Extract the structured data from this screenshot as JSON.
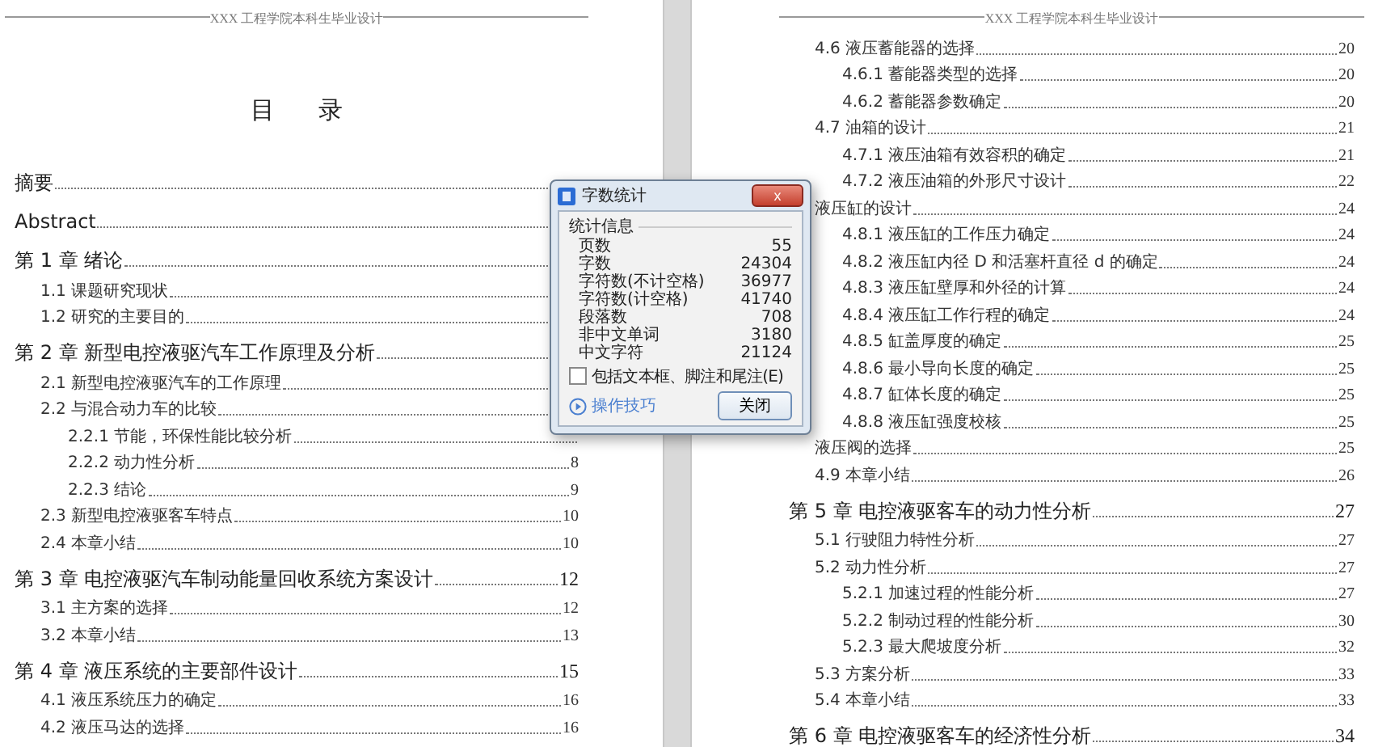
{
  "pages": [
    {
      "header": "XXX 工程学院本科生毕业设计",
      "title": "目 录",
      "entries": [
        {
          "kind": "chapter",
          "text": "摘要"
        },
        {
          "kind": "chapter",
          "text": "Abstract"
        },
        {
          "kind": "chapter",
          "text": "第 1 章  绪论",
          "children": [
            {
              "kind": "section",
              "text": "1.1 课题研究现状"
            },
            {
              "kind": "section",
              "text": "1.2 研究的主要目的"
            }
          ]
        },
        {
          "kind": "chapter",
          "text": "第 2 章  新型电控液驱汽车工作原理及分析",
          "children": [
            {
              "kind": "section",
              "text": "2.1 新型电控液驱汽车的工作原理"
            },
            {
              "kind": "section",
              "text": "2.2 与混合动力车的比较",
              "children": [
                {
                  "kind": "subsection",
                  "text": "2.2.1  节能，环保性能比较分析"
                },
                {
                  "kind": "subsection",
                  "text": "2.2.2  动力性分析",
                  "page": "8"
                },
                {
                  "kind": "subsection",
                  "text": "2.2.3 结论",
                  "page": "9"
                }
              ]
            },
            {
              "kind": "section",
              "text": "2.3 新型电控液驱客车特点",
              "page": "10"
            },
            {
              "kind": "section",
              "text": "2.4 本章小结",
              "page": "10"
            }
          ]
        },
        {
          "kind": "chapter",
          "text": "第 3 章  电控液驱汽车制动能量回收系统方案设计",
          "page": "12",
          "children": [
            {
              "kind": "section",
              "text": "3.1 主方案的选择",
              "page": "12"
            },
            {
              "kind": "section",
              "text": "3.2 本章小结",
              "page": "13"
            }
          ]
        },
        {
          "kind": "chapter",
          "text": "第 4 章  液压系统的主要部件设计",
          "page": "15",
          "children": [
            {
              "kind": "section",
              "text": "4.1 液压系统压力的确定",
              "page": "16"
            },
            {
              "kind": "section",
              "text": "4.2 液压马达的选择",
              "page": "16"
            }
          ]
        }
      ]
    },
    {
      "header": "XXX 工程学院本科生毕业设计",
      "entries": [
        {
          "kind": "section",
          "text": "4.6 液压蓄能器的选择",
          "page": "20",
          "children": [
            {
              "kind": "subsection",
              "text": "4.6.1  蓄能器类型的选择",
              "page": "20"
            },
            {
              "kind": "subsection",
              "text": "4.6.2  蓄能器参数确定",
              "page": "20"
            }
          ]
        },
        {
          "kind": "section",
          "text": "4.7 油箱的设计",
          "page": "21",
          "children": [
            {
              "kind": "subsection",
              "text": "4.7.1  液压油箱有效容积的确定",
              "page": "21"
            },
            {
              "kind": "subsection",
              "text": "4.7.2   液压油箱的外形尺寸设计",
              "page": "22"
            }
          ]
        },
        {
          "kind": "section",
          "text": "液压缸的设计",
          "page": "24",
          "children": [
            {
              "kind": "subsection",
              "text": "4.8.1 液压缸的工作压力确定",
              "page": "24"
            },
            {
              "kind": "subsection",
              "text": "4.8.2 液压缸内径 D 和活塞杆直径 d 的确定",
              "page": "24"
            },
            {
              "kind": "subsection",
              "text": "4.8.3  液压缸壁厚和外径的计算",
              "page": "24"
            },
            {
              "kind": "subsection",
              "text": "4.8.4  液压缸工作行程的确定",
              "page": "24"
            },
            {
              "kind": "subsection",
              "text": "4.8.5 缸盖厚度的确定",
              "page": "25"
            },
            {
              "kind": "subsection",
              "text": "4.8.6  最小导向长度的确定",
              "page": "25"
            },
            {
              "kind": "subsection",
              "text": "4.8.7  缸体长度的确定",
              "page": "25"
            },
            {
              "kind": "subsection",
              "text": "4.8.8  液压缸强度校核",
              "page": "25"
            }
          ]
        },
        {
          "kind": "section",
          "text": "液压阀的选择",
          "page": "25"
        },
        {
          "kind": "section",
          "text": "4.9 本章小结",
          "page": "26"
        },
        {
          "kind": "chapter",
          "text": "第 5 章  电控液驱客车的动力性分析",
          "page": "27",
          "children": [
            {
              "kind": "section",
              "text": "5.1  行驶阻力特性分析",
              "page": "27"
            },
            {
              "kind": "section",
              "text": "5.2 动力性分析",
              "page": "27",
              "children": [
                {
                  "kind": "subsection",
                  "text": "5.2.1  加速过程的性能分析",
                  "page": "27"
                },
                {
                  "kind": "subsection",
                  "text": "5.2.2 制动过程的性能分析",
                  "page": "30"
                },
                {
                  "kind": "subsection",
                  "text": "5.2.3 最大爬坡度分析",
                  "page": "32"
                }
              ]
            },
            {
              "kind": "section",
              "text": "5.3 方案分析",
              "page": "33"
            },
            {
              "kind": "section",
              "text": "5.4 本章小结",
              "page": "33"
            }
          ]
        },
        {
          "kind": "chapter",
          "text": "第 6 章  电控液驱客车的经济性分析",
          "page": "34"
        }
      ]
    }
  ],
  "dialog": {
    "title": "字数统计",
    "close": "x",
    "group": "统计信息",
    "stats": [
      {
        "label": "页数",
        "value": "55"
      },
      {
        "label": "字数",
        "value": "24304"
      },
      {
        "label": "字符数(不计空格)",
        "value": "36977"
      },
      {
        "label": "字符数(计空格)",
        "value": "41740"
      },
      {
        "label": "段落数",
        "value": "708"
      },
      {
        "label": "非中文单词",
        "value": "3180"
      },
      {
        "label": "中文字符",
        "value": "21124"
      }
    ],
    "checkbox": {
      "label": "包括文本框、脚注和尾注(E)",
      "checked": false
    },
    "tips_link": "操作技巧",
    "close_button": "关闭"
  }
}
